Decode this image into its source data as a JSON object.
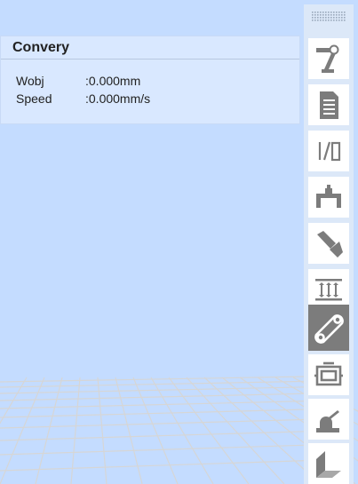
{
  "panel": {
    "title": "Convery",
    "rows": [
      {
        "label": "Wobj",
        "value": ":0.000mm"
      },
      {
        "label": "Speed",
        "value": ":0.000mm/s"
      }
    ]
  },
  "toolbar": {
    "tools": [
      {
        "icon": "robot-arm-icon",
        "active": false
      },
      {
        "icon": "document-icon",
        "active": false
      },
      {
        "icon": "io-icon",
        "active": false
      },
      {
        "icon": "gripper-icon",
        "active": false
      },
      {
        "icon": "vacuum-tool-icon",
        "active": false
      },
      {
        "icon": "press-icon",
        "active": false
      },
      {
        "icon": "conveyor-icon",
        "active": true
      },
      {
        "icon": "motor-icon",
        "active": false
      },
      {
        "icon": "single-axis-icon",
        "active": false
      },
      {
        "icon": "surface-icon",
        "active": false
      }
    ]
  },
  "colors": {
    "background": "#c4dcff",
    "panel": "#d9e8ff",
    "icon": "#7c7c7c",
    "active": "#7c7c7c"
  }
}
